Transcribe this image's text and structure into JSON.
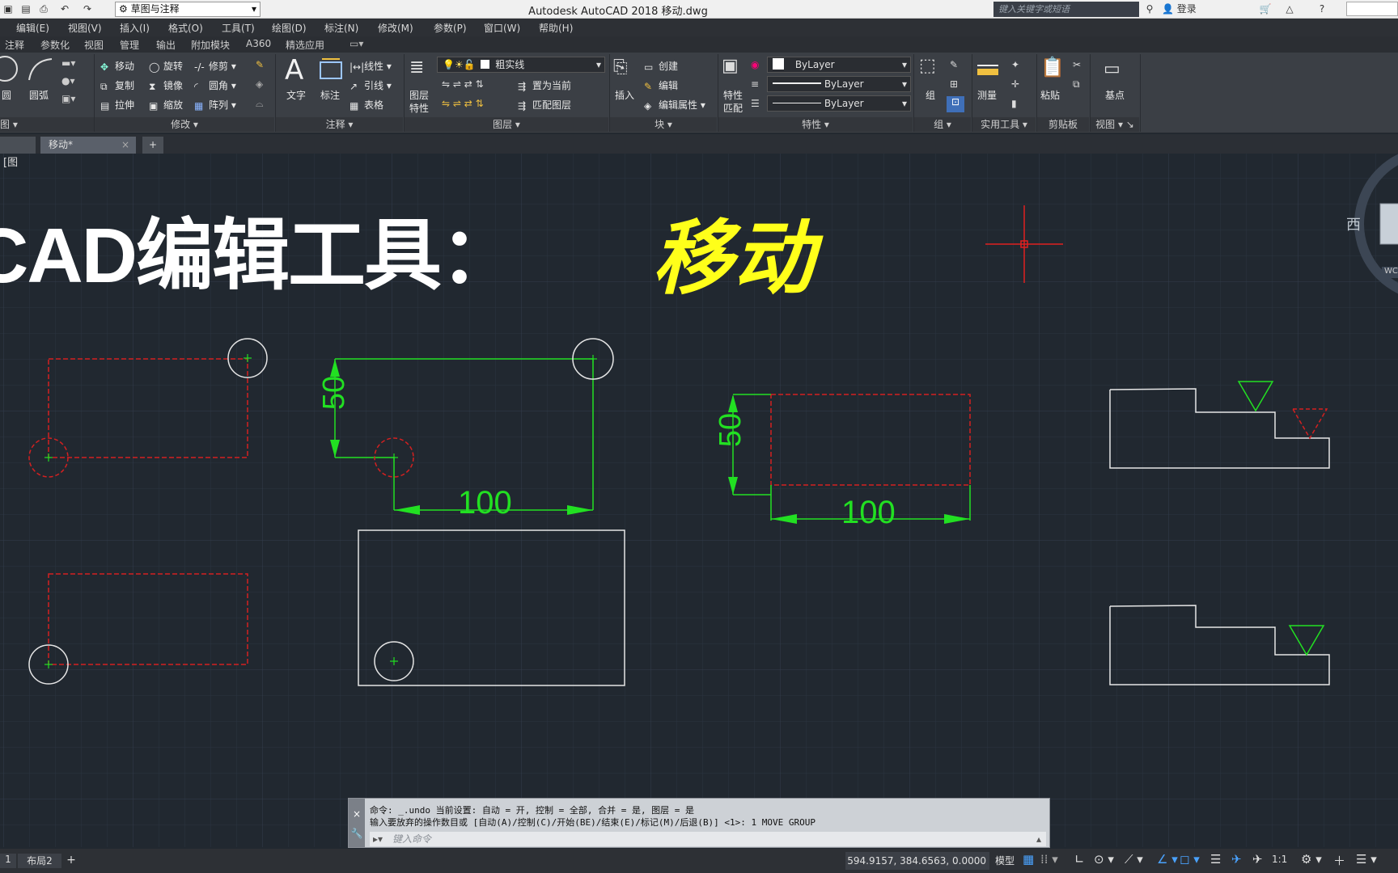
{
  "titlebar": {
    "app_title": "Autodesk AutoCAD 2018    移动.dwg",
    "workspace": "草图与注释",
    "search_placeholder": "键入关键字或短语",
    "login": "登录"
  },
  "menubar": {
    "items": [
      "编辑(E)",
      "视图(V)",
      "插入(I)",
      "格式(O)",
      "工具(T)",
      "绘图(D)",
      "标注(N)",
      "修改(M)",
      "参数(P)",
      "窗口(W)",
      "帮助(H)"
    ]
  },
  "ribbon_tabs": [
    "注释",
    "参数化",
    "视图",
    "管理",
    "输出",
    "附加模块",
    "A360",
    "精选应用"
  ],
  "ribbon": {
    "draw": {
      "circle": "圆",
      "arc": "圆弧",
      "title": "图"
    },
    "modify": {
      "move": "移动",
      "rotate": "旋转",
      "trim": "修剪",
      "copy": "复制",
      "mirror": "镜像",
      "fillet": "圆角",
      "stretch": "拉伸",
      "scale": "缩放",
      "array": "阵列",
      "title": "修改"
    },
    "annotation": {
      "text": "文字",
      "dim": "标注",
      "linetype": "线性",
      "leader": "引线",
      "table": "表格",
      "title": "注释"
    },
    "layers": {
      "layer_props_1": "图层",
      "layer_props_2": "特性",
      "current_layer": "粗实线",
      "set_current": "置为当前",
      "match_layer": "匹配图层",
      "title": "图层"
    },
    "block": {
      "insert": "插入",
      "create": "创建",
      "edit": "编辑",
      "edit_attr": "编辑属性",
      "title": "块"
    },
    "properties": {
      "match_1": "特性",
      "match_2": "匹配",
      "color": "ByLayer",
      "linetype": "ByLayer",
      "lineweight": "ByLayer",
      "title": "特性"
    },
    "groups": {
      "group": "组",
      "title": "组"
    },
    "utilities": {
      "measure": "测量",
      "title": "实用工具"
    },
    "clipboard": {
      "paste": "粘贴",
      "title": "剪贴板"
    },
    "view": {
      "base": "基点",
      "title": "视图"
    }
  },
  "doctabs": {
    "current": "移动*"
  },
  "canvas": {
    "viewport_label": "[图",
    "heading_white": "CAD编辑工具：",
    "heading_yellow": "移动",
    "viewcube_west": "西",
    "wcs": "WC",
    "dims": {
      "d1_vertical": "50",
      "d1_horizontal": "100",
      "d2_vertical": "50",
      "d2_horizontal": "100"
    }
  },
  "command": {
    "line1": "命令:  _.undo 当前设置: 自动 = 开, 控制 = 全部, 合并 = 是, 图层 = 是",
    "line2": "输入要放弃的操作数目或 [自动(A)/控制(C)/开始(BE)/结束(E)/标记(M)/后退(B)] <1>: 1 MOVE GROUP",
    "placeholder": "键入命令"
  },
  "statusbar": {
    "tab_1": "1",
    "tab_layout2": "布局2",
    "coords": "594.9157, 384.6563, 0.0000",
    "model": "模型",
    "scale": "1:1"
  },
  "colors": {
    "canvas_bg": "#212830",
    "grid": "#2c3440",
    "dim_green": "#22e022",
    "red_dash": "#d42020",
    "heading_yellow": "#ffff1a"
  }
}
